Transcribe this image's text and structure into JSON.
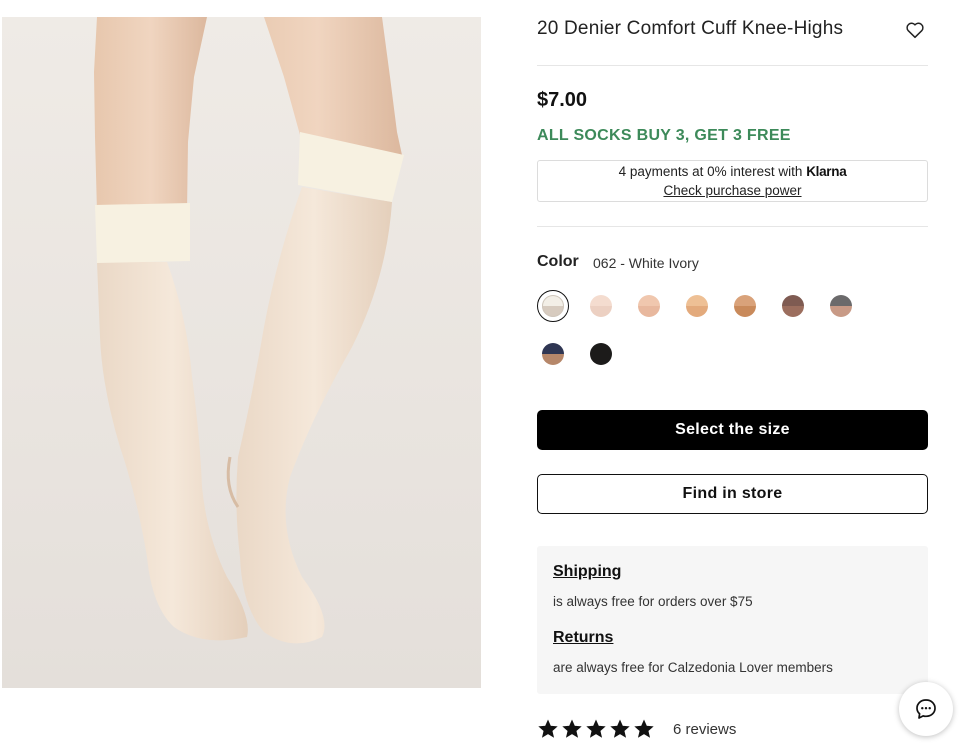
{
  "product": {
    "title": "20 Denier Comfort Cuff Knee-Highs",
    "price": "$7.00",
    "promo": "ALL SOCKS BUY 3, GET 3 FREE",
    "image_icon": "product-photo-legs-knee-highs"
  },
  "klarna": {
    "text_before": "4 payments at 0% interest with ",
    "logo": "Klarna",
    "link": "Check purchase power"
  },
  "color": {
    "label": "Color",
    "selected_value": "062 - White Ivory",
    "swatches": [
      {
        "name": "White Ivory",
        "top": "#f3efe7",
        "bottom": "#d7cbbf"
      },
      {
        "name": "Light Nude",
        "top": "#f4dccf",
        "bottom": "#ecd0c2"
      },
      {
        "name": "Nude",
        "top": "#f0c7ae",
        "bottom": "#e8b89e"
      },
      {
        "name": "Tan",
        "top": "#eec095",
        "bottom": "#e3aa7c"
      },
      {
        "name": "Bronze",
        "top": "#d9a27a",
        "bottom": "#c98a5b"
      },
      {
        "name": "Brown",
        "top": "#7f5b52",
        "bottom": "#9c6e5e"
      },
      {
        "name": "Grey",
        "top": "#6b6a6b",
        "bottom": "#c89a86"
      },
      {
        "name": "Navy",
        "top": "#2f3653",
        "bottom": "#b6876a"
      },
      {
        "name": "Black",
        "top": "#1c1b1a",
        "bottom": "#1c1b1a"
      }
    ]
  },
  "buttons": {
    "select_size": "Select the size",
    "find_in_store": "Find in store"
  },
  "info": {
    "shipping_heading": "Shipping",
    "shipping_text": "is always free for orders over $75",
    "returns_heading": "Returns",
    "returns_text": "are always free for Calzedonia Lover members"
  },
  "reviews": {
    "rating": 5,
    "max": 5,
    "count_text": "6 reviews"
  },
  "icons": {
    "wishlist": "heart-icon",
    "chat": "chat-bubble-icon",
    "star": "star-icon"
  },
  "colors": {
    "promo": "#3d8a5a",
    "primary_button": "#000000",
    "panel_bg": "#f6f6f6"
  }
}
